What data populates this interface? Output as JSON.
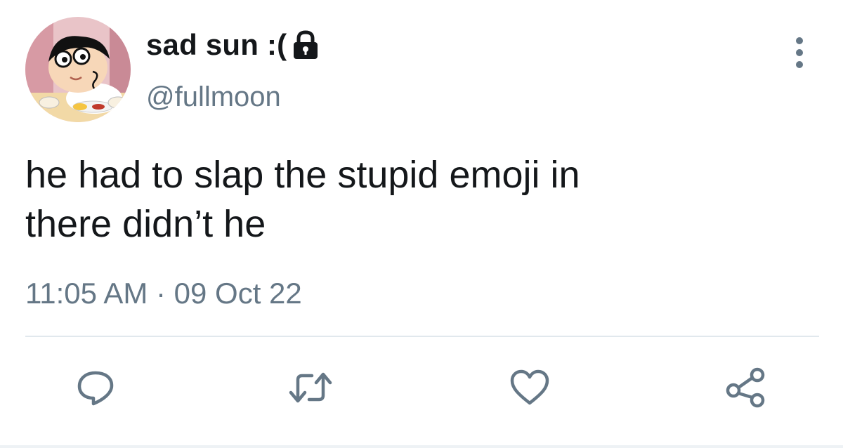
{
  "tweet": {
    "display_name": "sad sun :(",
    "handle": "@fullmoon",
    "text": "he had to slap the stupid emoji in\nthere didn’t he",
    "timestamp": "11:05 AM · 09 Oct 22"
  },
  "icons": {
    "protected": "lock-icon",
    "more": "more-vertical-icon",
    "reply": "reply-icon",
    "retweet": "retweet-icon",
    "like": "heart-icon",
    "share": "share-icon"
  },
  "colors": {
    "text_primary": "#14171a",
    "text_secondary": "#657786",
    "icon": "#657786",
    "divider": "#e1e8ed"
  }
}
